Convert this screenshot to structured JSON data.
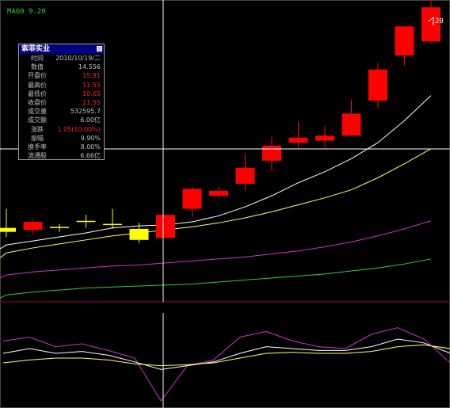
{
  "indicator_label": "MA60 9.20",
  "max_price_label": "20",
  "info_panel": {
    "title": "索菲实业",
    "rows": [
      {
        "key": "时间",
        "value": "2010/10/19/二",
        "color": "#c0c0c0"
      },
      {
        "key": "数值",
        "value": "14.556",
        "color": "#c0c0c0"
      },
      {
        "key": "开盘价",
        "value": "15.91",
        "color": "#ff2020"
      },
      {
        "key": "最高价",
        "value": "11.55",
        "color": "#ff2020"
      },
      {
        "key": "最低价",
        "value": "10.65",
        "color": "#ff2020"
      },
      {
        "key": "收盘价",
        "value": "11.55",
        "color": "#ff2020"
      },
      {
        "key": "成交量",
        "value": "532595.7",
        "color": "#c0c0c0"
      },
      {
        "key": "成交额",
        "value": "6.00亿",
        "color": "#c0c0c0"
      },
      {
        "key": "涨跌",
        "value": "1.05(10.00%)",
        "color": "#ff2020"
      },
      {
        "key": "振幅",
        "value": "9.90%",
        "color": "#c0c0c0"
      },
      {
        "key": "换手率",
        "value": "8.00%",
        "color": "#c0c0c0"
      },
      {
        "key": "流通股",
        "value": "6.66亿",
        "color": "#c0c0c0"
      }
    ]
  },
  "colors": {
    "up": "#ff0000",
    "down": "#ffff00",
    "ma_white": "#ffffff",
    "ma_yellow": "#ffff66",
    "ma_magenta": "#cc33cc",
    "ma_green": "#33cc33",
    "separator": "#990033",
    "crosshair": "#ffffff"
  },
  "chart_data": {
    "type": "candlestick",
    "price_range": [
      4.3,
      19.0
    ],
    "candles": [
      {
        "open": 7.95,
        "close": 7.75,
        "high": 8.9,
        "low": 7.5
      },
      {
        "open": 7.85,
        "close": 8.25,
        "high": 8.35,
        "low": 7.6
      },
      {
        "open": 8.0,
        "close": 7.95,
        "high": 8.15,
        "low": 7.75
      },
      {
        "open": 8.3,
        "close": 8.25,
        "high": 8.6,
        "low": 7.95
      },
      {
        "open": 8.15,
        "close": 8.1,
        "high": 8.9,
        "low": 7.9
      },
      {
        "open": 7.9,
        "close": 7.35,
        "high": 8.2,
        "low": 7.2
      },
      {
        "open": 7.45,
        "close": 8.6,
        "high": 8.6,
        "low": 7.45
      },
      {
        "open": 8.9,
        "close": 9.9,
        "high": 10.0,
        "low": 8.5
      },
      {
        "open": 9.55,
        "close": 9.8,
        "high": 10.0,
        "low": 9.45
      },
      {
        "open": 10.15,
        "close": 10.95,
        "high": 11.65,
        "low": 9.8
      },
      {
        "open": 11.3,
        "close": 12.05,
        "high": 12.5,
        "low": 10.8
      },
      {
        "open": 12.2,
        "close": 12.45,
        "high": 13.25,
        "low": 11.9
      },
      {
        "open": 12.3,
        "close": 12.55,
        "high": 13.05,
        "low": 11.95
      },
      {
        "open": 12.55,
        "close": 13.65,
        "high": 14.35,
        "low": 12.5
      },
      {
        "open": 14.3,
        "close": 15.85,
        "high": 16.2,
        "low": 13.9
      },
      {
        "open": 16.55,
        "close": 18.0,
        "high": 18.0,
        "low": 16.05
      },
      {
        "open": 17.25,
        "close": 18.95,
        "high": 20.0,
        "low": 17.15
      }
    ],
    "ma_series": [
      {
        "color": "#ffffff",
        "values": [
          7.1,
          7.3,
          7.5,
          7.7,
          7.95,
          8.05,
          8.1,
          8.25,
          8.55,
          9.0,
          9.55,
          10.2,
          10.75,
          11.4,
          12.2,
          13.3,
          14.55
        ]
      },
      {
        "color": "#ffff66",
        "values": [
          6.7,
          6.95,
          7.15,
          7.35,
          7.55,
          7.7,
          7.85,
          8.0,
          8.2,
          8.45,
          8.75,
          9.1,
          9.45,
          9.85,
          10.45,
          11.15,
          11.9
        ]
      },
      {
        "color": "#cc33cc",
        "values": [
          5.6,
          5.75,
          5.85,
          5.95,
          6.05,
          6.1,
          6.2,
          6.3,
          6.4,
          6.5,
          6.65,
          6.8,
          7.0,
          7.25,
          7.55,
          7.9,
          8.3
        ]
      },
      {
        "color": "#33cc33",
        "values": [
          4.6,
          4.75,
          4.85,
          4.95,
          5.0,
          5.05,
          5.1,
          5.15,
          5.25,
          5.35,
          5.45,
          5.55,
          5.65,
          5.8,
          5.95,
          6.15,
          6.4
        ]
      }
    ],
    "indicator": {
      "range": [
        0,
        100
      ],
      "series": [
        {
          "color": "#cc33cc",
          "values": [
            68,
            72,
            62,
            65,
            58,
            50,
            5,
            42,
            48,
            72,
            78,
            68,
            62,
            60,
            75,
            82,
            70,
            45
          ]
        },
        {
          "color": "#ffffff",
          "values": [
            55,
            60,
            55,
            57,
            53,
            46,
            38,
            42,
            46,
            55,
            62,
            60,
            58,
            58,
            62,
            70,
            66,
            55
          ]
        },
        {
          "color": "#ffff66",
          "values": [
            45,
            48,
            50,
            50,
            48,
            44,
            42,
            43,
            45,
            50,
            55,
            56,
            55,
            55,
            57,
            62,
            64,
            60
          ]
        }
      ]
    }
  }
}
